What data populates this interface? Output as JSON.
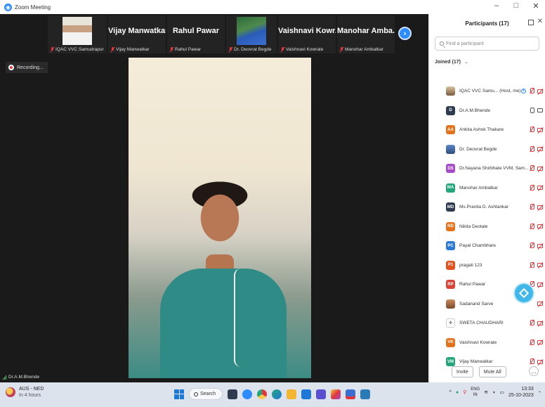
{
  "window": {
    "title": "Zoom Meeting",
    "controls": [
      "–",
      "□",
      "✕"
    ]
  },
  "gallery": {
    "tiles": [
      {
        "label": "IQAC VVC Samudrapur",
        "display_name": ""
      },
      {
        "label": "Vijay Manwatkar",
        "display_name": "Vijay Manwatkar"
      },
      {
        "label": "Rahul Pawar",
        "display_name": "Rahul Pawar"
      },
      {
        "label": "Dr. Deovrat Begde",
        "display_name": ""
      },
      {
        "label": "Vaishnavi Kowrate",
        "display_name": "Vaishnavi Kowr..."
      },
      {
        "label": "Manohar Ambatkar",
        "display_name": "Manohar Amba..."
      }
    ],
    "next_icon": "›"
  },
  "recording": {
    "label": "Recording..."
  },
  "speaker": {
    "name": "Dr.A.M.Bhende"
  },
  "participants_panel": {
    "title": "Participants (17)",
    "search_placeholder": "Find a participant",
    "group_label": "Joined (17)",
    "group_chevron": "⌄",
    "participants": [
      {
        "initials": "",
        "name": "IQAC VVC Samu... (Host, me)",
        "color": "#8a6a4a",
        "photo": true
      },
      {
        "initials": "D",
        "name": "Dr.A.M.Bhende",
        "color": "#2f3b4f"
      },
      {
        "initials": "AA",
        "name": "Ankita Ashok Thakare",
        "color": "#e2731c"
      },
      {
        "initials": "",
        "name": "Dr. Deovrat Begde",
        "color": "#4b6ea8",
        "photo": true
      },
      {
        "initials": "DS",
        "name": "Dr.Nayana Shirbhate.VVM, Sam...",
        "color": "#a54cc7"
      },
      {
        "initials": "MA",
        "name": "Manohar Ambatkar",
        "color": "#24a67a"
      },
      {
        "initials": "MD",
        "name": "Ms.Pranita D. Ashtankar",
        "color": "#2f3b4f"
      },
      {
        "initials": "ND",
        "name": "Nikita Deotale",
        "color": "#e2731c"
      },
      {
        "initials": "PC",
        "name": "Payal Chambhare",
        "color": "#2d7ad6"
      },
      {
        "initials": "P1",
        "name": "pragati 123",
        "color": "#e0531f"
      },
      {
        "initials": "RP",
        "name": "Rahul Pawar",
        "color": "#d8453a"
      },
      {
        "initials": "",
        "name": "Sadanand Sarve",
        "color": "#b9643b",
        "photo": true
      },
      {
        "initials": "",
        "name": "SWETA CHAUDHARI",
        "color": "#ffffff",
        "photo": false,
        "icon": "group"
      },
      {
        "initials": "VK",
        "name": "Vaishnavi Kowrate",
        "color": "#e2731c"
      },
      {
        "initials": "VM",
        "name": "Vijay Manwatkar",
        "color": "#24a67a"
      }
    ],
    "invite_label": "Invite",
    "mute_all_label": "Mute All",
    "more_label": "…"
  },
  "taskbar": {
    "weather_title": "AUS - NED",
    "weather_sub": "In 4 hours",
    "search_label": "Search",
    "lang_top": "ENG",
    "lang_bottom": "IN",
    "time": "13:33",
    "date": "25-10-2023"
  }
}
